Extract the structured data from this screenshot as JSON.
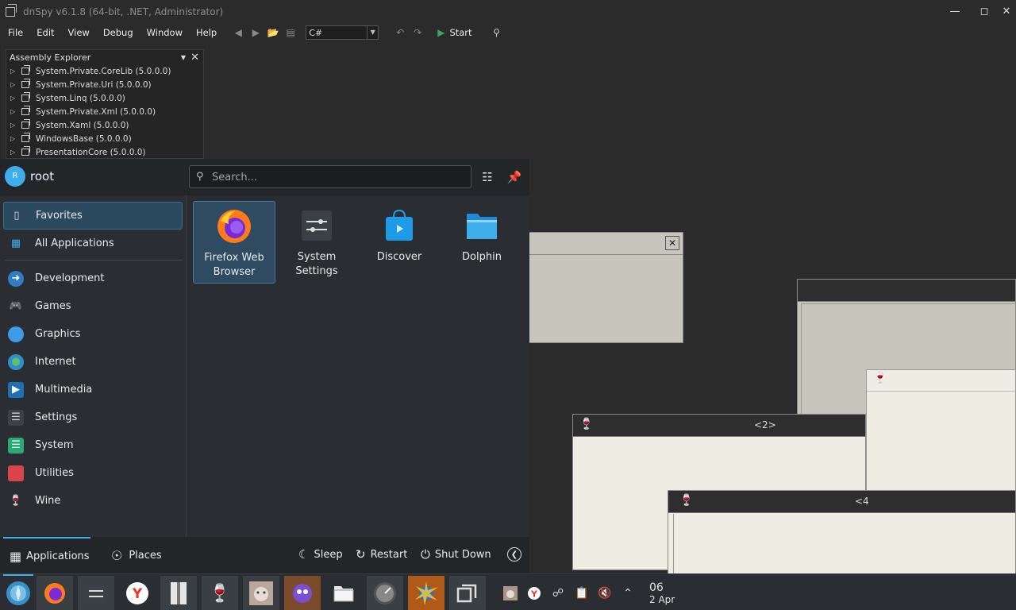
{
  "dnspy": {
    "title": "dnSpy v6.1.8 (64-bit, .NET, Administrator)",
    "menu": [
      "File",
      "Edit",
      "View",
      "Debug",
      "Window",
      "Help"
    ],
    "language": "C#",
    "start_label": "Start",
    "assembly_explorer": {
      "title": "Assembly Explorer",
      "items": [
        "System.Private.CoreLib (5.0.0.0)",
        "System.Private.Uri (5.0.0.0)",
        "System.Linq (5.0.0.0)",
        "System.Private.Xml (5.0.0.0)",
        "System.Xaml (5.0.0.0)",
        "WindowsBase (5.0.0.0)",
        "PresentationCore (5.0.0.0)"
      ]
    }
  },
  "bg_windows": {
    "win2_title": "<2>",
    "win4_title": "<4"
  },
  "launcher": {
    "user": {
      "initial": "R",
      "name": "root"
    },
    "search_placeholder": "Search...",
    "categories": [
      {
        "label": "Favorites",
        "icon": "bookmark-icon",
        "active": true
      },
      {
        "label": "All Applications",
        "icon": "grid-icon"
      },
      {
        "label": "Development",
        "icon": "development-icon"
      },
      {
        "label": "Games",
        "icon": "gamepad-icon"
      },
      {
        "label": "Graphics",
        "icon": "graphics-icon"
      },
      {
        "label": "Internet",
        "icon": "globe-icon"
      },
      {
        "label": "Multimedia",
        "icon": "monitor-icon"
      },
      {
        "label": "Settings",
        "icon": "settings-icon"
      },
      {
        "label": "System",
        "icon": "system-icon"
      },
      {
        "label": "Utilities",
        "icon": "toolbox-icon"
      },
      {
        "label": "Wine",
        "icon": "wine-icon"
      }
    ],
    "apps": [
      {
        "label": "Firefox Web Browser",
        "icon": "firefox-icon",
        "active": true
      },
      {
        "label": "System Settings",
        "icon": "system-settings-icon"
      },
      {
        "label": "Discover",
        "icon": "discover-icon"
      },
      {
        "label": "Dolphin",
        "icon": "folder-icon"
      }
    ],
    "footer": {
      "tab_applications": "Applications",
      "tab_places": "Places",
      "sleep": "Sleep",
      "restart": "Restart",
      "shutdown": "Shut Down"
    }
  },
  "taskbar": {
    "clock_time": "06",
    "clock_date": "2 Apr"
  },
  "colors": {
    "accent": "#3daee9",
    "launcher_bg": "#2a2e32",
    "panel_bg": "#232629"
  }
}
